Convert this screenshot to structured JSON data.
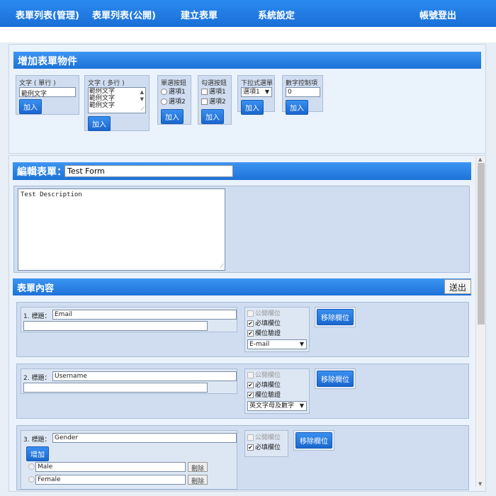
{
  "nav": {
    "items": [
      "表單列表(管理)",
      "表單列表(公開)",
      "建立表單",
      "系統設定"
    ],
    "logout": "帳號登出"
  },
  "add_panel": {
    "title": "增加表單物件",
    "add_label": "加入",
    "text_single": {
      "label": "文字 ( 單行 )",
      "value": "範例文字"
    },
    "text_multi": {
      "label": "文字 ( 多行 )",
      "lines": [
        "範例文字",
        "範例文字",
        "範例文字"
      ]
    },
    "radio": {
      "label": "單選按鈕",
      "options": [
        "選項1",
        "選項2"
      ]
    },
    "checkbox": {
      "label": "勾選按鈕",
      "options": [
        "選項1",
        "選項2"
      ]
    },
    "dropdown": {
      "label": "下拉式選單",
      "value": "選項1"
    },
    "number": {
      "label": "數字控制項",
      "value": "0"
    }
  },
  "edit_panel": {
    "title_label": "編輯表單：",
    "form_title": "Test Form",
    "description": "Test Description",
    "content_title": "表單內容",
    "submit_label": "送出"
  },
  "field_labels": {
    "title_prefix": "標題：",
    "public": "公開欄位",
    "required": "必填欄位",
    "validate": "欄位驗證",
    "remove": "移除欄位",
    "add": "增加",
    "delete": "刪除"
  },
  "fields": [
    {
      "num": "1.",
      "title": "Email",
      "public": false,
      "required": true,
      "validate": true,
      "validation": "E-mail"
    },
    {
      "num": "2.",
      "title": "Username",
      "public": false,
      "required": true,
      "validate": true,
      "validation": "英文字母及數字"
    },
    {
      "num": "3.",
      "title": "Gender",
      "public": false,
      "required": true,
      "options": [
        "Male",
        "Female"
      ]
    }
  ]
}
